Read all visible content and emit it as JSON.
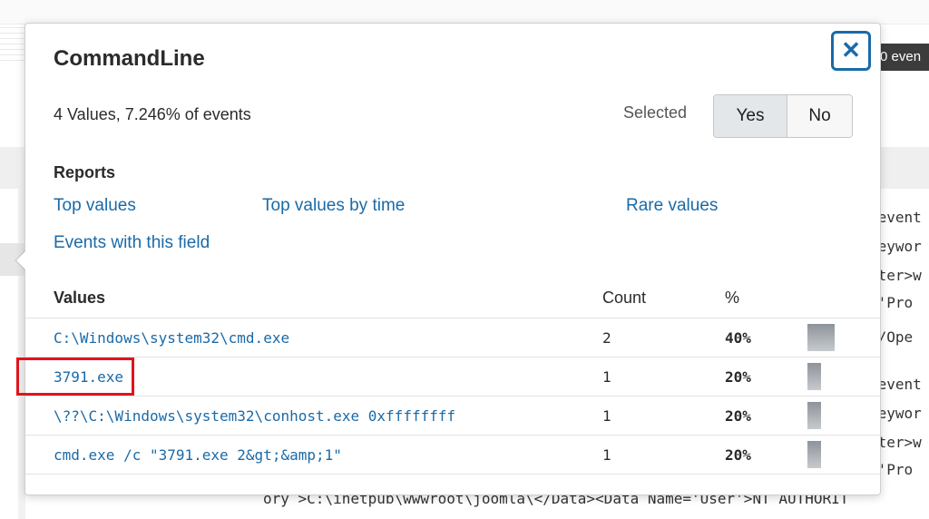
{
  "background": {
    "events_badge": "0 even",
    "raw_lines": [
      "/event",
      "Keywor",
      "ıter>w",
      "='Pro",
      "n/Ope",
      "/event",
      "Keywor",
      "ıter>w",
      "='Pro"
    ],
    "raw_bottom": "ory >C:\\inetpub\\wwwroot\\joomla\\</Data><Data Name='User'>NT AUTHORIT"
  },
  "popup": {
    "title": "CommandLine",
    "close_icon": "close-icon",
    "summary": "4 Values, 7.246% of events",
    "selected_label": "Selected",
    "toggle": {
      "yes": "Yes",
      "no": "No",
      "selected": "Yes"
    },
    "reports_heading": "Reports",
    "reports": {
      "top_values": "Top values",
      "top_values_by_time": "Top values by time",
      "rare_values": "Rare values",
      "events_with_field": "Events with this field"
    },
    "table": {
      "headers": {
        "values": "Values",
        "count": "Count",
        "percent": "%"
      },
      "rows": [
        {
          "value": "C:\\Windows\\system32\\cmd.exe",
          "count": "2",
          "percent": "40%",
          "fraction": 0.4
        },
        {
          "value": "3791.exe",
          "count": "1",
          "percent": "20%",
          "fraction": 0.2
        },
        {
          "value": "\\??\\C:\\Windows\\system32\\conhost.exe 0xffffffff",
          "count": "1",
          "percent": "20%",
          "fraction": 0.2
        },
        {
          "value": "cmd.exe /c \"3791.exe 2&gt;&amp;1\"",
          "count": "1",
          "percent": "20%",
          "fraction": 0.2
        }
      ]
    }
  },
  "colors": {
    "link": "#1a6aa8",
    "highlight": "#e0141e",
    "close_border": "#1a6aa8"
  }
}
